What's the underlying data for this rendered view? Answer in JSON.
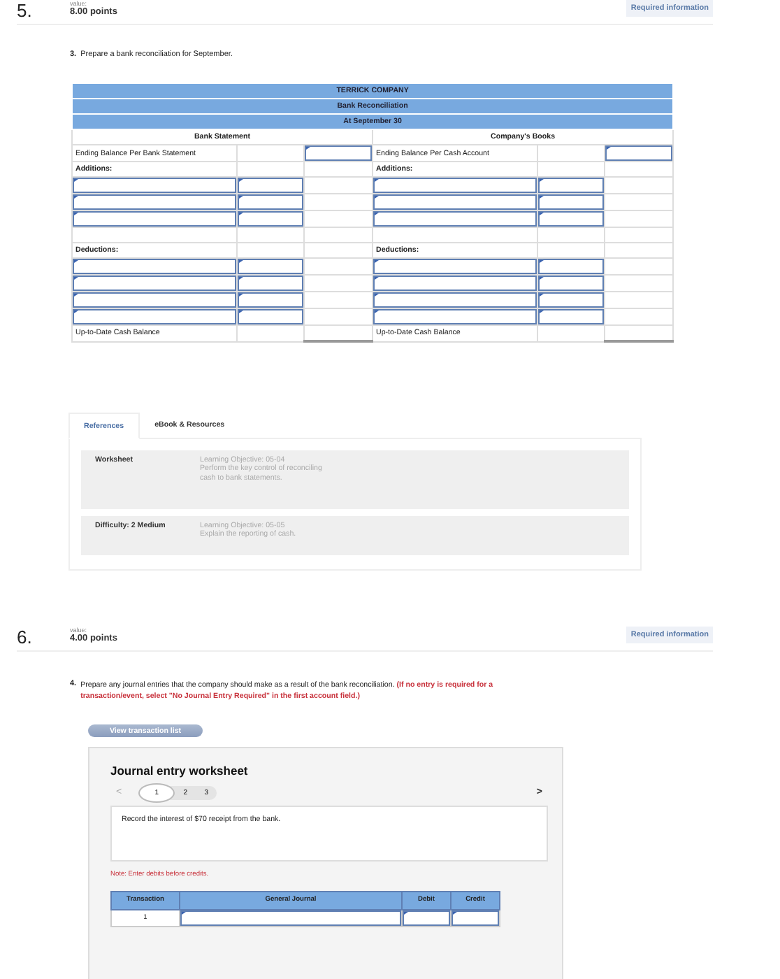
{
  "question5": {
    "number": "5.",
    "value_label": "value:",
    "points": "8.00 points",
    "required": "Required information",
    "part": "3.",
    "prompt": "Prepare a bank reconciliation for September."
  },
  "reconciliation": {
    "titles": [
      "TERRICK COMPANY",
      "Bank Reconciliation",
      "At September 30"
    ],
    "bank_heading": "Bank Statement",
    "books_heading": "Company's Books",
    "rows": [
      {
        "kind": "balance",
        "left": "Ending Balance Per Bank Statement",
        "right": "Ending Balance Per Cash Account"
      },
      {
        "kind": "section",
        "left": "Additions:",
        "right": "Additions:"
      },
      {
        "kind": "entry"
      },
      {
        "kind": "entry"
      },
      {
        "kind": "entry"
      },
      {
        "kind": "blank"
      },
      {
        "kind": "section",
        "left": "Deductions:",
        "right": "Deductions:"
      },
      {
        "kind": "entry"
      },
      {
        "kind": "entry"
      },
      {
        "kind": "entry"
      },
      {
        "kind": "entry"
      },
      {
        "kind": "total",
        "left": "Up-to-Date Cash Balance",
        "right": "Up-to-Date Cash Balance"
      }
    ]
  },
  "references": {
    "tabs": [
      {
        "label": "References",
        "selected": true
      },
      {
        "label": "eBook & Resources",
        "selected": false
      }
    ],
    "items": [
      {
        "label": "Worksheet",
        "objective": "Learning Objective: 05-04",
        "description": "Perform the key control of reconciling cash to bank statements."
      },
      {
        "label": "Difficulty: 2 Medium",
        "objective": "Learning Objective: 05-05",
        "description": "Explain the reporting of cash."
      }
    ]
  },
  "question6": {
    "number": "6.",
    "value_label": "value:",
    "points": "4.00 points",
    "required": "Required information",
    "part": "4.",
    "prompt": "Prepare any journal entries that the company should make as a result of the bank reconciliation.",
    "instruction": "(If no entry is required for a transaction/event, select \"No Journal Entry Required\" in the first account field.)"
  },
  "transaction_button": "View transaction list",
  "worksheet": {
    "title": "Journal entry worksheet",
    "prev": "<",
    "next": ">",
    "pages": [
      {
        "label": "1",
        "selected": true
      },
      {
        "label": "2",
        "selected": false
      },
      {
        "label": "3",
        "selected": false
      }
    ],
    "task": "Record the interest of $70 receipt from the bank.",
    "note": "Note: Enter debits before credits.",
    "columns": [
      "Transaction",
      "General Journal",
      "Debit",
      "Credit"
    ],
    "rows": [
      {
        "transaction": "1"
      }
    ]
  }
}
